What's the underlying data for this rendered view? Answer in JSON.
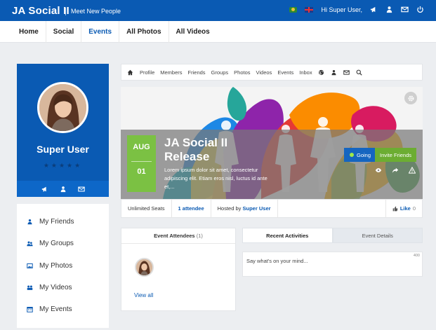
{
  "header": {
    "brand": "JA Social II",
    "tagline": "Meet New People",
    "greeting": "Hi Super User,",
    "icons": [
      "flag-icon",
      "uk-flag-icon",
      "megaphone-icon",
      "friends-icon",
      "mail-icon",
      "power-icon"
    ]
  },
  "main_nav": {
    "tabs": [
      {
        "label": "Home",
        "active": false
      },
      {
        "label": "Social",
        "active": false
      },
      {
        "label": "Events",
        "active": true
      },
      {
        "label": "All Photos",
        "active": false
      },
      {
        "label": "All Videos",
        "active": false
      }
    ]
  },
  "profile": {
    "name": "Super User",
    "rating": "★★★★★",
    "actions": [
      "megaphone-icon",
      "friends-icon",
      "mail-icon"
    ]
  },
  "sidebar": {
    "items": [
      {
        "label": "My Friends",
        "icon": "friends-icon"
      },
      {
        "label": "My Groups",
        "icon": "groups-icon"
      },
      {
        "label": "My Photos",
        "icon": "photos-icon"
      },
      {
        "label": "My Videos",
        "icon": "videos-icon"
      },
      {
        "label": "My Events",
        "icon": "calendar-icon"
      }
    ]
  },
  "subnav": {
    "items": [
      "Profile",
      "Members",
      "Friends",
      "Groups",
      "Photos",
      "Videos",
      "Events",
      "Inbox"
    ]
  },
  "event": {
    "month": "AUG",
    "day": "01",
    "title": "JA Social II Release",
    "description": "Lorem ipsum dolor sit amet, consectetur adipiscing elit. Etiam eros nisl, luctus id ante et,...",
    "going_label": "Going",
    "invite_label": "Invite Friends"
  },
  "info_bar": {
    "seats": "Unlimited Seats",
    "attendees": "1 attendee",
    "hosted_prefix": "Hosted by",
    "host": "Super User",
    "like_label": "Like",
    "like_count": "0"
  },
  "attendees_panel": {
    "title": "Event Attendees",
    "count": "(1)",
    "view_all": "View all"
  },
  "activity": {
    "tabs": [
      {
        "label": "Recent Activities",
        "active": true
      },
      {
        "label": "Event Details",
        "active": false
      }
    ],
    "placeholder": "Say what's on your mind...",
    "char_limit": "400"
  },
  "colors": {
    "primary": "#0a5ab3",
    "accent_green": "#7bc143",
    "invite_green": "#6cad32"
  }
}
